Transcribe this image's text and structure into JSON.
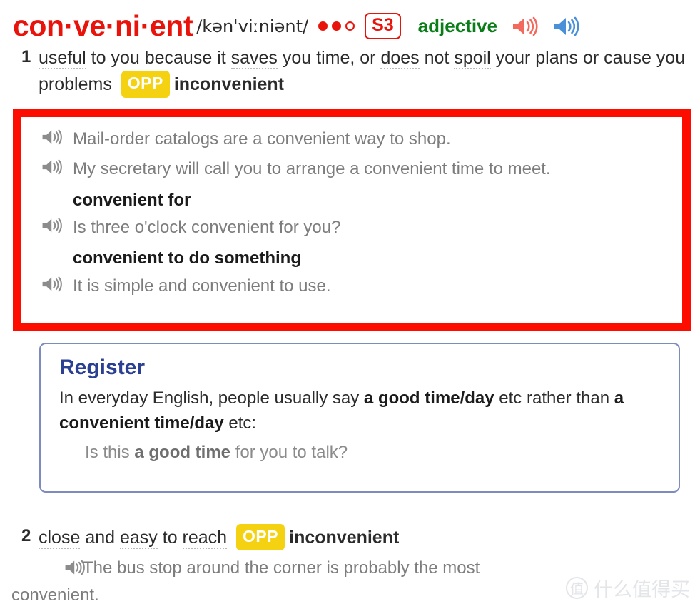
{
  "entry": {
    "headword": "con·ve·ni·ent",
    "pronunciation": "/kənˈviːniənt/",
    "frequency_dots": [
      "filled",
      "filled",
      "hollow"
    ],
    "frequency_badge": "S3",
    "part_of_speech": "adjective",
    "audio_us_icon": "speaker-icon",
    "audio_uk_icon": "speaker-icon",
    "colors": {
      "headword": "#e8140c",
      "badge": "#e8140c",
      "pos": "#0a7d18",
      "opp_badge_bg": "#f5d211",
      "annotation_box": "#fc0d00",
      "register_title": "#2b3f93",
      "speaker_red": "#f4695e",
      "speaker_blue": "#4a90d9",
      "speaker_gray": "#8c8c8c"
    }
  },
  "senses": [
    {
      "number": "1",
      "definition_parts": [
        {
          "text": "useful",
          "glossary": true
        },
        {
          "text": " to you because it ",
          "glossary": false
        },
        {
          "text": "saves",
          "glossary": true
        },
        {
          "text": " you time, or ",
          "glossary": false
        },
        {
          "text": "does",
          "glossary": true
        },
        {
          "text": " not ",
          "glossary": false
        },
        {
          "text": "spoil",
          "glossary": true
        },
        {
          "text": " your plans or cause you problems ",
          "glossary": false
        }
      ],
      "opp_label": "OPP",
      "opp_word": "inconvenient"
    },
    {
      "number": "2",
      "definition_parts": [
        {
          "text": "close",
          "glossary": true
        },
        {
          "text": " and ",
          "glossary": false
        },
        {
          "text": "easy",
          "glossary": true
        },
        {
          "text": " to ",
          "glossary": false
        },
        {
          "text": "reach",
          "glossary": true
        },
        {
          "text": " ",
          "glossary": false
        }
      ],
      "opp_label": "OPP",
      "opp_word": "inconvenient"
    }
  ],
  "highlighted_examples": {
    "items": [
      {
        "kind": "example",
        "text": "Mail-order catalogs are a convenient way to shop."
      },
      {
        "kind": "example",
        "text": "My secretary will call you to arrange a convenient time to meet."
      },
      {
        "kind": "collocation",
        "text": "convenient for"
      },
      {
        "kind": "example",
        "text": "Is three o'clock convenient for you?"
      },
      {
        "kind": "collocation",
        "text": "convenient to do something"
      },
      {
        "kind": "example",
        "text": "It is simple and convenient to use."
      }
    ]
  },
  "register": {
    "title": "Register",
    "body_1": "In everyday English, people usually say ",
    "body_bold_1": "a good time/day",
    "body_2": " etc rather than ",
    "body_bold_2": "a convenient time/day",
    "body_3": " etc:",
    "example_1": "Is this ",
    "example_bold": "a good time",
    "example_2": " for you to talk?"
  },
  "sense2_example": {
    "line_1": "The bus stop around the corner is probably the most",
    "line_2": "convenient."
  },
  "watermark": {
    "mark": "值",
    "text": "什么值得买"
  }
}
